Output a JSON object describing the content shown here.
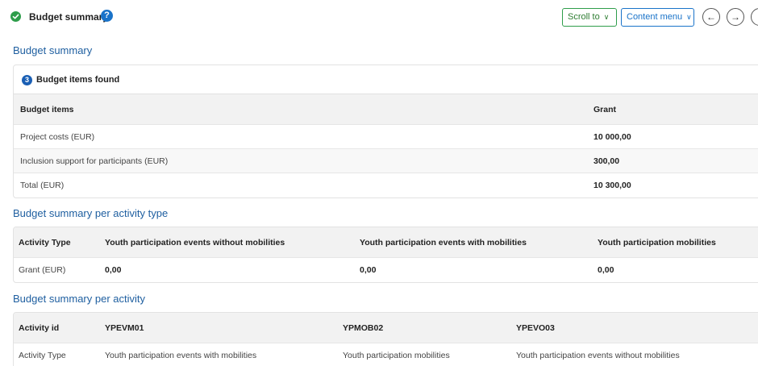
{
  "header": {
    "title": "Budget summary",
    "scroll_to_label": "Scroll to",
    "content_menu_label": "Content menu",
    "help_glyph": "?",
    "prev_glyph": "←",
    "next_glyph": "→"
  },
  "colors": {
    "success": "#2e9d4b",
    "primary": "#1a73c9",
    "section_title": "#1f5fa0"
  },
  "budget_summary": {
    "title": "Budget summary",
    "count": "3",
    "found_label": "Budget items found",
    "columns": [
      "Budget items",
      "Grant"
    ],
    "rows": [
      {
        "item": "Project costs (EUR)",
        "grant": "10 000,00"
      },
      {
        "item": "Inclusion support for participants (EUR)",
        "grant": "300,00"
      },
      {
        "item": "Total (EUR)",
        "grant": "10 300,00"
      }
    ]
  },
  "per_activity_type": {
    "title": "Budget summary per activity type",
    "columns": [
      "Activity Type",
      "Youth participation events without mobilities",
      "Youth participation events with mobilities",
      "Youth participation mobilities"
    ],
    "row": {
      "label": "Grant (EUR)",
      "values": [
        "0,00",
        "0,00",
        "0,00"
      ]
    }
  },
  "per_activity": {
    "title": "Budget summary per activity",
    "columns": [
      "Activity id",
      "YPEVM01",
      "YPMOB02",
      "YPEVO03"
    ],
    "row": {
      "label": "Activity Type",
      "values": [
        "Youth participation events with mobilities",
        "Youth participation mobilities",
        "Youth participation events without mobilities"
      ]
    }
  }
}
